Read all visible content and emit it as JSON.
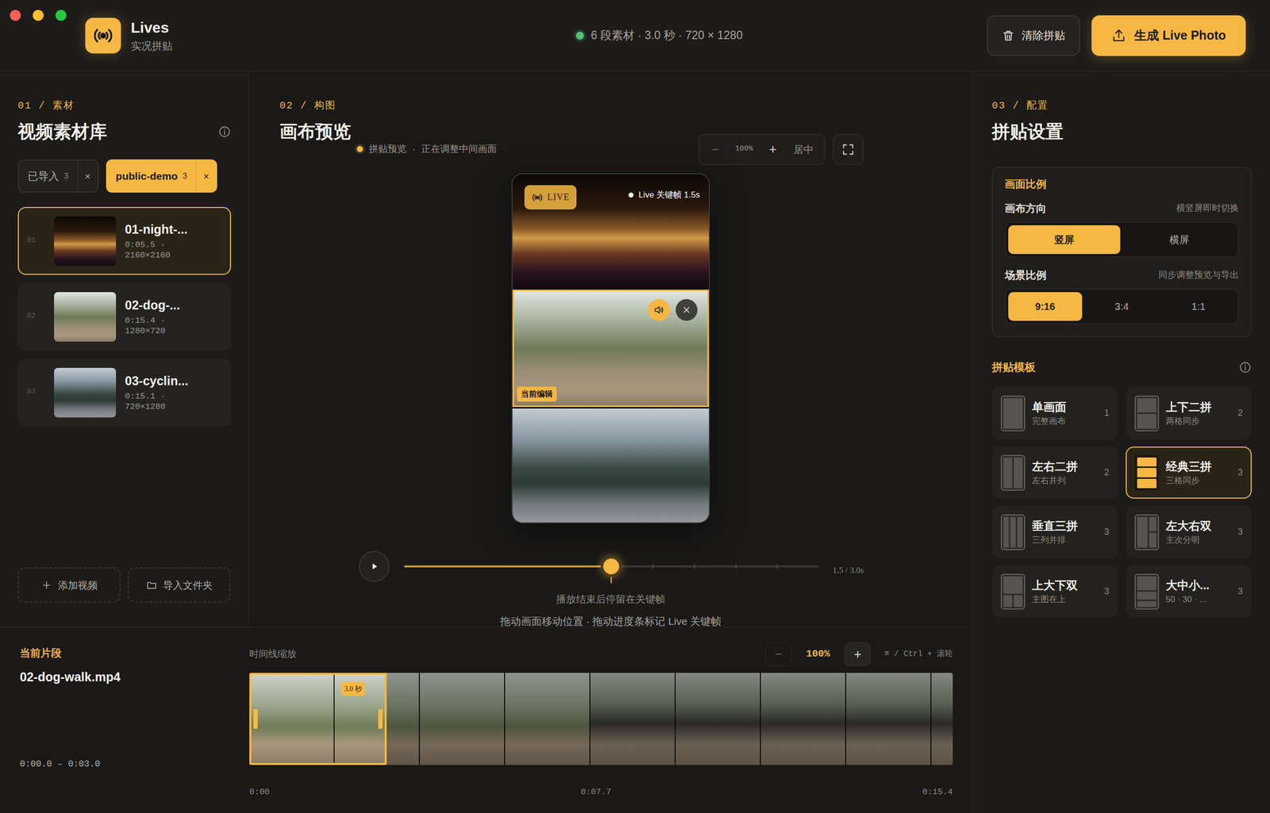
{
  "app": {
    "name": "Lives",
    "subtitle": "实况拼贴"
  },
  "status": {
    "text": "6 段素材 · 3.0 秒 · 720 × 1280",
    "ok": true
  },
  "header_buttons": [
    {
      "label": "清除拼贴",
      "kind": "secondary"
    },
    {
      "label": "生成 Live Photo",
      "kind": "primary"
    }
  ],
  "library": {
    "step": "01 / 素材",
    "title": "视频素材库",
    "sources": [
      {
        "label": "已导入",
        "count": "3",
        "close": "×",
        "selected": false
      },
      {
        "label": "public-demo",
        "count": "3",
        "close": "×",
        "selected": true
      }
    ],
    "videos": [
      {
        "index": "01",
        "name": "01-night-...",
        "duration": "0:05.5 ·",
        "size": "2160×2160",
        "kind": "night",
        "selected": true
      },
      {
        "index": "02",
        "name": "02-dog-...",
        "duration": "0:15.4 ·",
        "size": "1280×720",
        "kind": "dog",
        "selected": false
      },
      {
        "index": "03",
        "name": "03-cyclin...",
        "duration": "0:15.1 ·",
        "size": "720×1280",
        "kind": "cycling",
        "selected": false
      }
    ],
    "actions": [
      {
        "label": "添加视频",
        "kind": "add"
      },
      {
        "label": "导入文件夹",
        "kind": "folder"
      }
    ]
  },
  "composition": {
    "step": "02 / 构图",
    "title": "画布预览",
    "hint_label": "拼贴预览",
    "hint_sep": "·",
    "hint_state": "正在调整中间画面",
    "zoom": {
      "minus": "−",
      "value": "100%",
      "plus": "+",
      "center": "居中"
    },
    "canvas": {
      "live_badge": "LIVE",
      "keyframe": "Live 关键帧 1.5s",
      "editing_badge": "当前编辑",
      "panes": [
        {
          "kind": "night",
          "selected": false
        },
        {
          "kind": "dog",
          "selected": true
        },
        {
          "kind": "cycling",
          "selected": false
        }
      ]
    },
    "player": {
      "playing": false,
      "level": 0.5,
      "reading": "1.5 / 3.0s",
      "note": "播放结束后停留在关键帧",
      "help": "拖动画面移动位置 · 拖动进度条标记 Live 关键帧"
    }
  },
  "clip": {
    "label": "当前片段",
    "file": "02-dog-walk.mp4",
    "range": "0:00.0 – 0:03.0"
  },
  "timeline": {
    "label": "时间线缩放",
    "minus": "−",
    "zoom": "100%",
    "plus": "+",
    "shortcut": "⌘ / Ctrl + 滚轮",
    "selection_badge": "3.0 秒",
    "selection": {
      "start": 0,
      "end": 0.195
    },
    "ticks": [
      "0:00",
      "0:07.7",
      "0:15.4"
    ]
  },
  "settings": {
    "step": "03 / 配置",
    "title": "拼贴设置",
    "ratio": {
      "title": "画面比例",
      "orientation": {
        "label": "画布方向",
        "hint": "横竖屏即时切换",
        "options": [
          {
            "label": "竖屏",
            "selected": true
          },
          {
            "label": "横屏",
            "selected": false
          }
        ]
      },
      "scene": {
        "label": "场景比例",
        "hint": "同步调整预览与导出",
        "options": [
          {
            "label": "9:16",
            "selected": true
          },
          {
            "label": "3:4",
            "selected": false
          },
          {
            "label": "1:1",
            "selected": false
          }
        ]
      }
    },
    "templates": {
      "title": "拼贴模板",
      "items": [
        {
          "name": "单画面",
          "desc": "完整画布",
          "count": "1",
          "kind": "single",
          "selected": false
        },
        {
          "name": "上下二拼",
          "desc": "两格同步",
          "count": "2",
          "kind": "rows2",
          "selected": false
        },
        {
          "name": "左右二拼",
          "desc": "左右并列",
          "count": "2",
          "kind": "cols2",
          "selected": false
        },
        {
          "name": "经典三拼",
          "desc": "三格同步",
          "count": "3",
          "kind": "rows3",
          "selected": true
        },
        {
          "name": "垂直三拼",
          "desc": "三列并排",
          "count": "3",
          "kind": "cols3",
          "selected": false
        },
        {
          "name": "左大右双",
          "desc": "主次分明",
          "count": "3",
          "kind": "bigleft",
          "selected": false
        },
        {
          "name": "上大下双",
          "desc": "主图在上",
          "count": "3",
          "kind": "bigtop",
          "selected": false
        },
        {
          "name": "大中小...",
          "desc": "50 · 30 · ...",
          "count": "3",
          "kind": "stack3",
          "selected": false
        }
      ]
    }
  }
}
